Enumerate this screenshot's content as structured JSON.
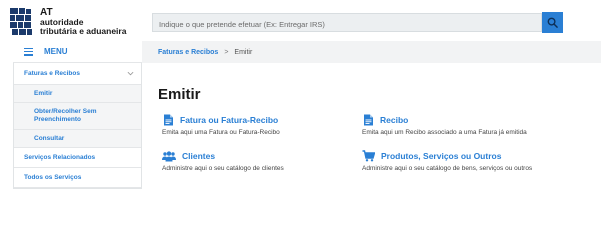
{
  "logo": {
    "line1": "AT",
    "line2": "autoridade",
    "line3": "tributária e aduaneira"
  },
  "search": {
    "placeholder": "Indique o que pretende efetuar (Ex: Entregar IRS)"
  },
  "menu": {
    "label": "MENU"
  },
  "breadcrumb": {
    "parent": "Faturas e Recibos",
    "separator": ">",
    "current": "Emitir"
  },
  "sidebar": {
    "items": [
      {
        "label": "Faturas e Recibos"
      },
      {
        "label": "Emitir"
      },
      {
        "label": "Obter/Recolher Sem Preenchimento"
      },
      {
        "label": "Consultar"
      },
      {
        "label": "Serviços Relacionados"
      },
      {
        "label": "Todos os Serviços"
      }
    ]
  },
  "main": {
    "title": "Emitir",
    "cards": [
      {
        "title": "Fatura ou Fatura-Recibo",
        "desc": "Emita aqui uma Fatura ou Fatura-Recibo",
        "icon": "document-icon"
      },
      {
        "title": "Recibo",
        "desc": "Emita aqui um Recibo associado a uma Fatura já emitida",
        "icon": "document-icon"
      },
      {
        "title": "Clientes",
        "desc": "Administre aqui o seu catálogo de clientes",
        "icon": "users-icon"
      },
      {
        "title": "Produtos, Serviços ou Outros",
        "desc": "Administre aqui o seu catálogo de bens, serviços ou outros",
        "icon": "cart-icon"
      }
    ]
  },
  "colors": {
    "accent": "#2a7fd4",
    "breadcrumb_bg": "#f2f3f4",
    "submenu_bg": "#f4f5f6"
  }
}
